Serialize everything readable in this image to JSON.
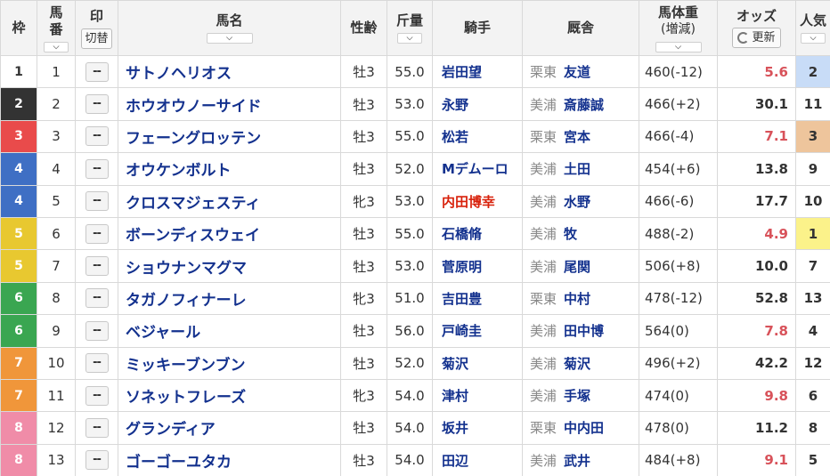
{
  "header": {
    "waku": "枠",
    "umaban_1": "馬",
    "umaban_2": "番",
    "mark": "印",
    "mark_toggle": "切替",
    "name": "馬名",
    "sexage": "性齢",
    "kinryo": "斤量",
    "jockey": "騎手",
    "stable": "厩舎",
    "weight": "馬体重",
    "weight_sub": "(増減)",
    "odds": "オッズ",
    "odds_refresh": "更新",
    "pop_1": "人気"
  },
  "waku_colors": {
    "1": {
      "bg": "#ffffff",
      "fg": "#333333"
    },
    "2": {
      "bg": "#333333",
      "fg": "#ffffff"
    },
    "3": {
      "bg": "#e94b4b",
      "fg": "#ffffff"
    },
    "4": {
      "bg": "#3f6fc4",
      "fg": "#ffffff"
    },
    "5": {
      "bg": "#e8c830",
      "fg": "#ffffff"
    },
    "6": {
      "bg": "#3aa651",
      "fg": "#ffffff"
    },
    "7": {
      "bg": "#f0963a",
      "fg": "#ffffff"
    },
    "8": {
      "bg": "#f08ca8",
      "fg": "#ffffff"
    }
  },
  "rows": [
    {
      "waku": "1",
      "umaban": "1",
      "mark": "--",
      "name": "サトノヘリオス",
      "sexage": "牡3",
      "kinryo": "55.0",
      "jockey": "岩田望",
      "jockey_red": false,
      "area": "栗東",
      "trainer": "友道",
      "weight": "460(-12)",
      "odds": "5.6",
      "odds_hot": true,
      "pop": "2"
    },
    {
      "waku": "2",
      "umaban": "2",
      "mark": "--",
      "name": "ホウオウノーサイド",
      "sexage": "牡3",
      "kinryo": "53.0",
      "jockey": "永野",
      "jockey_red": false,
      "area": "美浦",
      "trainer": "斎藤誠",
      "weight": "466(+2)",
      "odds": "30.1",
      "odds_hot": false,
      "pop": "11"
    },
    {
      "waku": "3",
      "umaban": "3",
      "mark": "--",
      "name": "フェーングロッテン",
      "sexage": "牡3",
      "kinryo": "55.0",
      "jockey": "松若",
      "jockey_red": false,
      "area": "栗東",
      "trainer": "宮本",
      "weight": "466(-4)",
      "odds": "7.1",
      "odds_hot": true,
      "pop": "3"
    },
    {
      "waku": "4",
      "umaban": "4",
      "mark": "--",
      "name": "オウケンボルト",
      "sexage": "牡3",
      "kinryo": "52.0",
      "jockey": "Mデムーロ",
      "jockey_red": false,
      "area": "美浦",
      "trainer": "土田",
      "weight": "454(+6)",
      "odds": "13.8",
      "odds_hot": false,
      "pop": "9"
    },
    {
      "waku": "4",
      "umaban": "5",
      "mark": "--",
      "name": "クロスマジェスティ",
      "sexage": "牝3",
      "kinryo": "53.0",
      "jockey": "内田博幸",
      "jockey_red": true,
      "area": "美浦",
      "trainer": "水野",
      "weight": "466(-6)",
      "odds": "17.7",
      "odds_hot": false,
      "pop": "10"
    },
    {
      "waku": "5",
      "umaban": "6",
      "mark": "--",
      "name": "ボーンディスウェイ",
      "sexage": "牡3",
      "kinryo": "55.0",
      "jockey": "石橋脩",
      "jockey_red": false,
      "area": "美浦",
      "trainer": "牧",
      "weight": "488(-2)",
      "odds": "4.9",
      "odds_hot": true,
      "pop": "1"
    },
    {
      "waku": "5",
      "umaban": "7",
      "mark": "--",
      "name": "ショウナンマグマ",
      "sexage": "牡3",
      "kinryo": "53.0",
      "jockey": "菅原明",
      "jockey_red": false,
      "area": "美浦",
      "trainer": "尾関",
      "weight": "506(+8)",
      "odds": "10.0",
      "odds_hot": false,
      "pop": "7"
    },
    {
      "waku": "6",
      "umaban": "8",
      "mark": "--",
      "name": "タガノフィナーレ",
      "sexage": "牝3",
      "kinryo": "51.0",
      "jockey": "吉田豊",
      "jockey_red": false,
      "area": "栗東",
      "trainer": "中村",
      "weight": "478(-12)",
      "odds": "52.8",
      "odds_hot": false,
      "pop": "13"
    },
    {
      "waku": "6",
      "umaban": "9",
      "mark": "--",
      "name": "ベジャール",
      "sexage": "牡3",
      "kinryo": "56.0",
      "jockey": "戸崎圭",
      "jockey_red": false,
      "area": "美浦",
      "trainer": "田中博",
      "weight": "564(0)",
      "odds": "7.8",
      "odds_hot": true,
      "pop": "4"
    },
    {
      "waku": "7",
      "umaban": "10",
      "mark": "--",
      "name": "ミッキーブンブン",
      "sexage": "牡3",
      "kinryo": "52.0",
      "jockey": "菊沢",
      "jockey_red": false,
      "area": "美浦",
      "trainer": "菊沢",
      "weight": "496(+2)",
      "odds": "42.2",
      "odds_hot": false,
      "pop": "12"
    },
    {
      "waku": "7",
      "umaban": "11",
      "mark": "--",
      "name": "ソネットフレーズ",
      "sexage": "牝3",
      "kinryo": "54.0",
      "jockey": "津村",
      "jockey_red": false,
      "area": "美浦",
      "trainer": "手塚",
      "weight": "474(0)",
      "odds": "9.8",
      "odds_hot": true,
      "pop": "6"
    },
    {
      "waku": "8",
      "umaban": "12",
      "mark": "--",
      "name": "グランディア",
      "sexage": "牡3",
      "kinryo": "54.0",
      "jockey": "坂井",
      "jockey_red": false,
      "area": "栗東",
      "trainer": "中内田",
      "weight": "478(0)",
      "odds": "11.2",
      "odds_hot": false,
      "pop": "8"
    },
    {
      "waku": "8",
      "umaban": "13",
      "mark": "--",
      "name": "ゴーゴーユタカ",
      "sexage": "牡3",
      "kinryo": "54.0",
      "jockey": "田辺",
      "jockey_red": false,
      "area": "美浦",
      "trainer": "武井",
      "weight": "484(+8)",
      "odds": "9.1",
      "odds_hot": true,
      "pop": "5"
    }
  ]
}
